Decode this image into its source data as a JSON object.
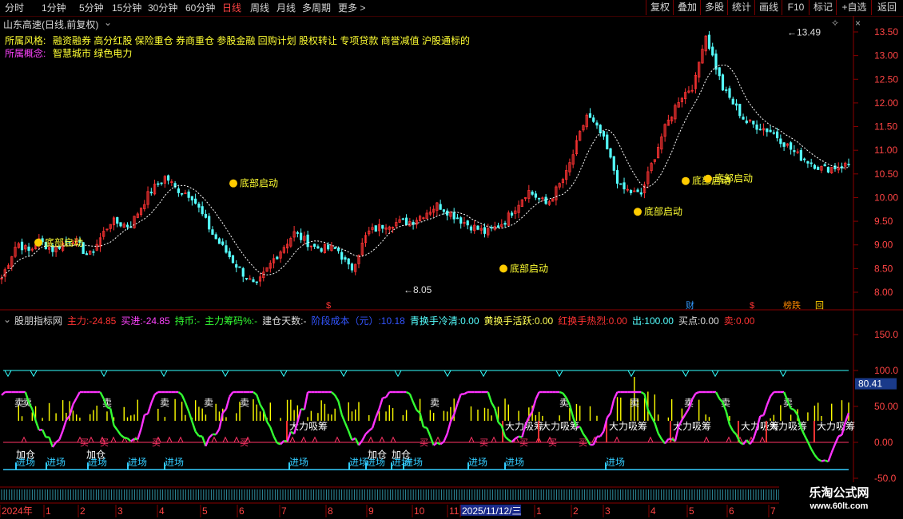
{
  "toolbar": {
    "periods": [
      "分时",
      "1分钟",
      "5分钟",
      "15分钟",
      "30分钟",
      "60分钟",
      "日线",
      "周线",
      "月线",
      "多周期",
      "更多 >"
    ],
    "active_period": "日线",
    "right_buttons": [
      "复权",
      "叠加",
      "多股",
      "统计",
      "画线",
      "F10",
      "+自选",
      "返回"
    ]
  },
  "main": {
    "title": "山东高速(日线,前复权)",
    "style_label": "所属风格:",
    "style_value": "融资融券 高分红股 保险重仓 券商重仓 参股金融 回购计划 股权转让 专项贷款 商誉减值 沪股通标的",
    "concept_label": "所属概念:",
    "concept_value": "智慧城市 绿色电力",
    "price_axis": [
      "13.50",
      "13.00",
      "12.50",
      "12.00",
      "11.50",
      "11.00",
      "10.50",
      "10.00",
      "9.50",
      "9.00",
      "8.50",
      "8.00"
    ],
    "high_label": "13.49",
    "low_label": "8.05",
    "signal_label": "底部启动",
    "event_markers": [
      "$",
      "财",
      "$",
      "榜跌",
      "回"
    ]
  },
  "indicator": {
    "name": "股朋指标网",
    "items": [
      {
        "label": "主力:",
        "value": "-24.85",
        "color": "#ff3333"
      },
      {
        "label": "买进:",
        "value": "-24.85",
        "color": "#ff44ff"
      },
      {
        "label": "持币:",
        "value": "-",
        "color": "#33ff33"
      },
      {
        "label": "主力筹码%:",
        "value": "-",
        "color": "#33ff33"
      },
      {
        "label": "建仓天数:",
        "value": "-",
        "color": "#dddddd"
      },
      {
        "label": "阶段成本（元）:",
        "value": "10.18",
        "color": "#3355ff"
      },
      {
        "label": "青换手冷清:",
        "value": "0.00",
        "color": "#55ffff"
      },
      {
        "label": "黄换手活跃:",
        "value": "0.00",
        "color": "#ffff55"
      },
      {
        "label": "红换手热烈:",
        "value": "0.00",
        "color": "#ff3333"
      },
      {
        "label": "出:",
        "value": "100.00",
        "color": "#55ffff"
      },
      {
        "label": "买点:",
        "value": "0.00",
        "color": "#dddddd"
      },
      {
        "label": "卖:",
        "value": "0.00",
        "color": "#ff3333"
      }
    ],
    "axis": [
      "150.0",
      "100.0",
      "80.41",
      "50.00",
      "0.00",
      "-50.0"
    ],
    "labels": {
      "sell": "卖",
      "buy": "买",
      "enter": "进场",
      "add": "加仓",
      "absorb": "大力吸筹"
    }
  },
  "timeline": {
    "labels": [
      "2024年",
      "1",
      "2",
      "3",
      "4",
      "5",
      "6",
      "7",
      "8",
      "9",
      "10",
      "11",
      "2025/11/12/三",
      "1",
      "2",
      "3",
      "4",
      "5",
      "6",
      "7"
    ]
  },
  "watermark": {
    "title": "乐淘公式网",
    "url": "www.60lt.com"
  },
  "colors": {
    "up": "#ff3333",
    "down": "#55ffff",
    "highlight": "#ffff00",
    "concept": "#ff44ff",
    "bg": "#000000"
  }
}
